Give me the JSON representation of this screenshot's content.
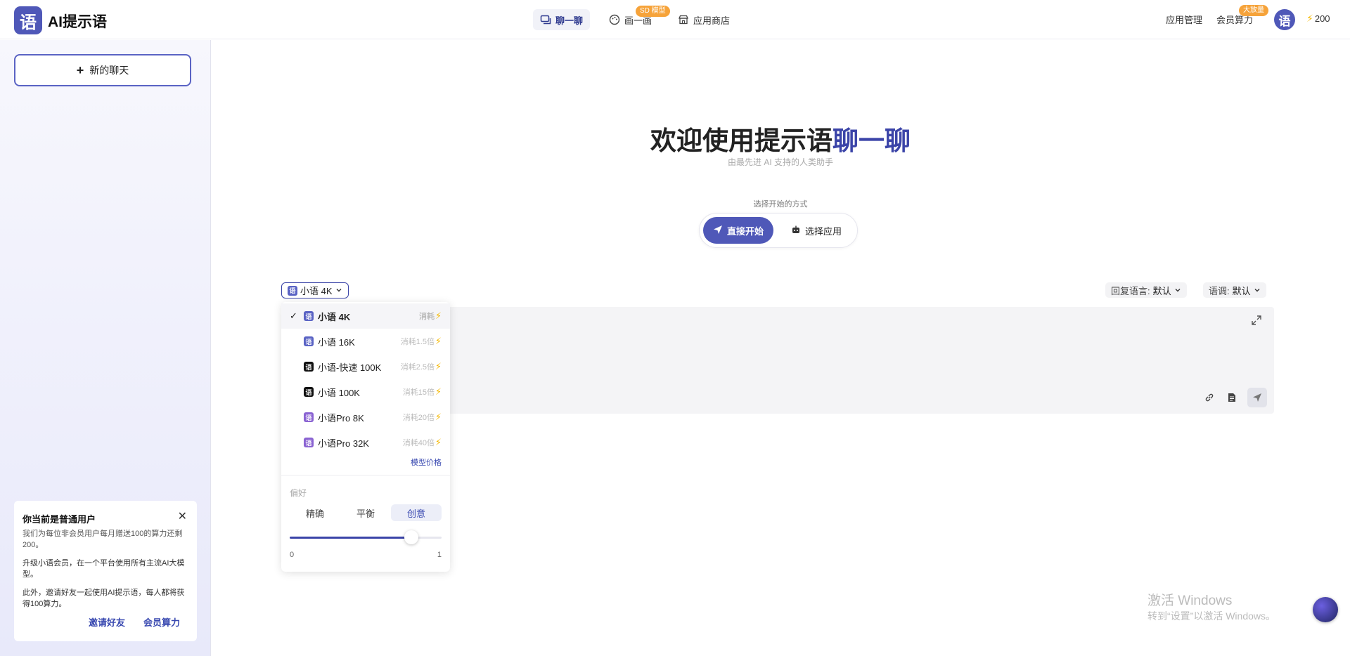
{
  "header": {
    "logo_char": "语",
    "brand": "AI提示语",
    "nav": [
      {
        "label": "聊一聊",
        "active": true
      },
      {
        "label": "画一画",
        "badge": "SD 模型"
      },
      {
        "label": "应用商店"
      }
    ],
    "app_manage": "应用管理",
    "member_power": "会员算力",
    "member_badge": "大放量",
    "avatar_char": "语",
    "credits": "200"
  },
  "sidebar": {
    "new_chat": "新的聊天",
    "promo": {
      "title": "你当前是普通用户",
      "p1": "我们为每位非会员用户每月赠送100的算力还剩200。",
      "p2": "升级小语会员，在一个平台使用所有主流AI大模型。",
      "p3": "此外，邀请好友一起使用AI提示语，每人都将获得100算力。",
      "invite": "邀请好友",
      "member": "会员算力"
    }
  },
  "main": {
    "welcome_prefix": "欢迎使用提示语",
    "welcome_accent": "聊一聊",
    "subtitle": "由最先进 AI 支持的人类助手",
    "choose_label": "选择开始的方式",
    "mode_direct": "直接开始",
    "mode_app": "选择应用",
    "model_selected": "小语 4K",
    "reply_lang_label": "回复语言:",
    "reply_lang_value": "默认",
    "tone_label": "语调:",
    "tone_value": "默认"
  },
  "dropdown": {
    "items": [
      {
        "name": "小语 4K",
        "cost": "消耗",
        "logo": "blue",
        "selected": true
      },
      {
        "name": "小语 16K",
        "cost": "消耗1.5倍",
        "logo": "blue"
      },
      {
        "name": "小语-快速 100K",
        "cost": "消耗2.5倍",
        "logo": "dark"
      },
      {
        "name": "小语 100K",
        "cost": "消耗15倍",
        "logo": "dark"
      },
      {
        "name": "小语Pro 8K",
        "cost": "消耗20倍",
        "logo": "purple"
      },
      {
        "name": "小语Pro 32K",
        "cost": "消耗40倍",
        "logo": "purple"
      }
    ],
    "price_link": "模型价格",
    "pref_label": "偏好",
    "pref_options": [
      "精确",
      "平衡",
      "创意"
    ],
    "pref_selected_index": 2,
    "slider_value": 0.8,
    "slider_min": "0",
    "slider_max": "1"
  },
  "watermark": {
    "line1": "激活 Windows",
    "line2": "转到“设置”以激活 Windows。"
  },
  "colors": {
    "accent": "#3b44a8",
    "primary": "#4f58b8",
    "badge": "#f6a33a",
    "bolt": "#f5b800"
  }
}
